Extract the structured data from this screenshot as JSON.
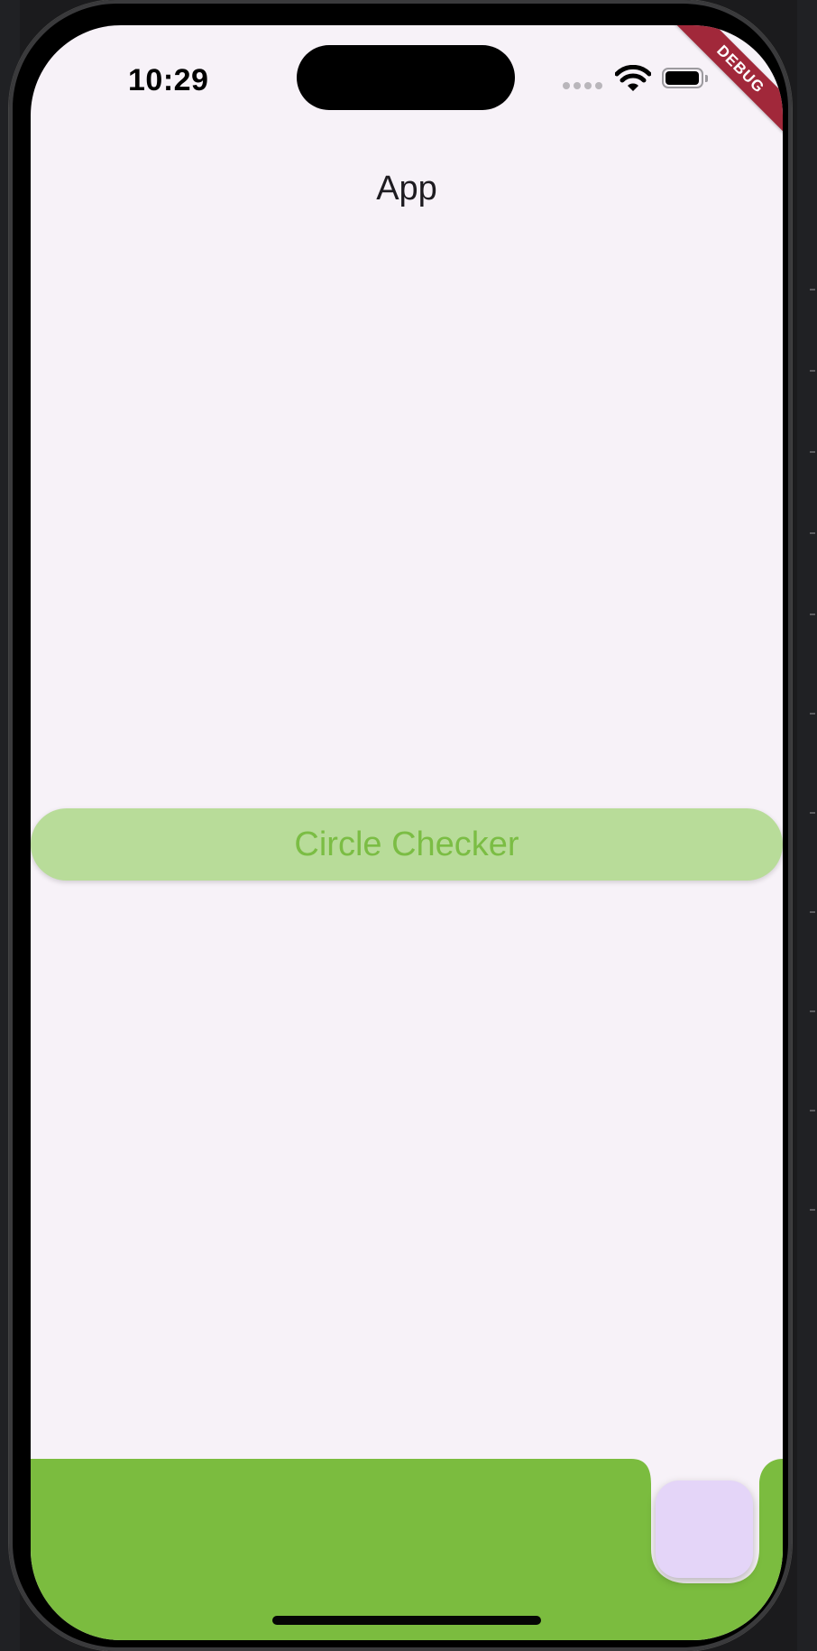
{
  "status_bar": {
    "time": "10:29",
    "icons": [
      "cellular-dots-icon",
      "wifi-icon",
      "battery-icon"
    ]
  },
  "debug_banner": {
    "label": "DEBUG",
    "color": "#a1283a"
  },
  "app_bar": {
    "title": "App"
  },
  "main": {
    "button_label": "Circle Checker",
    "button_color": "#b8dc99",
    "button_text_color": "#7bbd44"
  },
  "bottom_bar": {
    "color": "#7bbc3f"
  },
  "fab": {
    "color": "#e4d5f8"
  },
  "colors": {
    "screen_background": "#f7f2f8",
    "title_text": "#1d1b20"
  }
}
